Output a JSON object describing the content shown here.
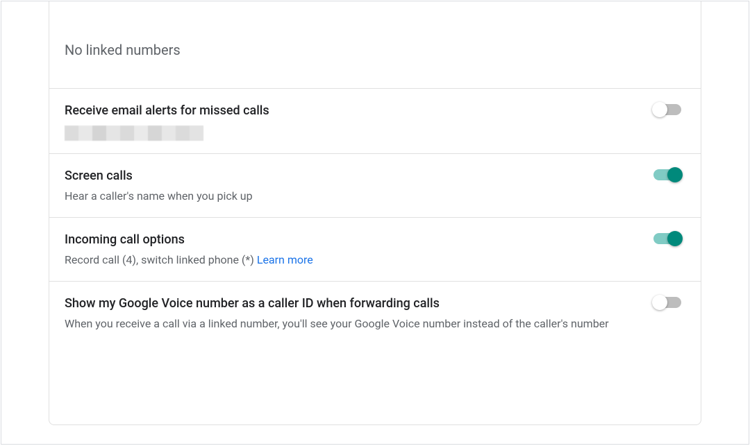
{
  "linked_numbers": {
    "title": "No linked numbers"
  },
  "settings": {
    "email_alerts": {
      "title": "Receive email alerts for missed calls",
      "enabled": false
    },
    "screen_calls": {
      "title": "Screen calls",
      "desc": "Hear a caller's name when you pick up",
      "enabled": true
    },
    "incoming_options": {
      "title": "Incoming call options",
      "desc": "Record call (4), switch linked phone (*) ",
      "learn_more": "Learn more",
      "enabled": true
    },
    "caller_id": {
      "title": "Show my Google Voice number as a caller ID when forwarding calls",
      "desc": "When you receive a call via a linked number, you'll see your Google Voice number instead of the caller's number",
      "enabled": false
    }
  },
  "colors": {
    "toggle_on_track": "#80cbc4",
    "toggle_on_thumb": "#00897b",
    "toggle_off_track": "#bdbdbd",
    "toggle_off_thumb": "#ffffff",
    "link": "#1a73e8",
    "text_primary": "#202124",
    "text_secondary": "#5f6368",
    "border": "#e0e0e0"
  }
}
